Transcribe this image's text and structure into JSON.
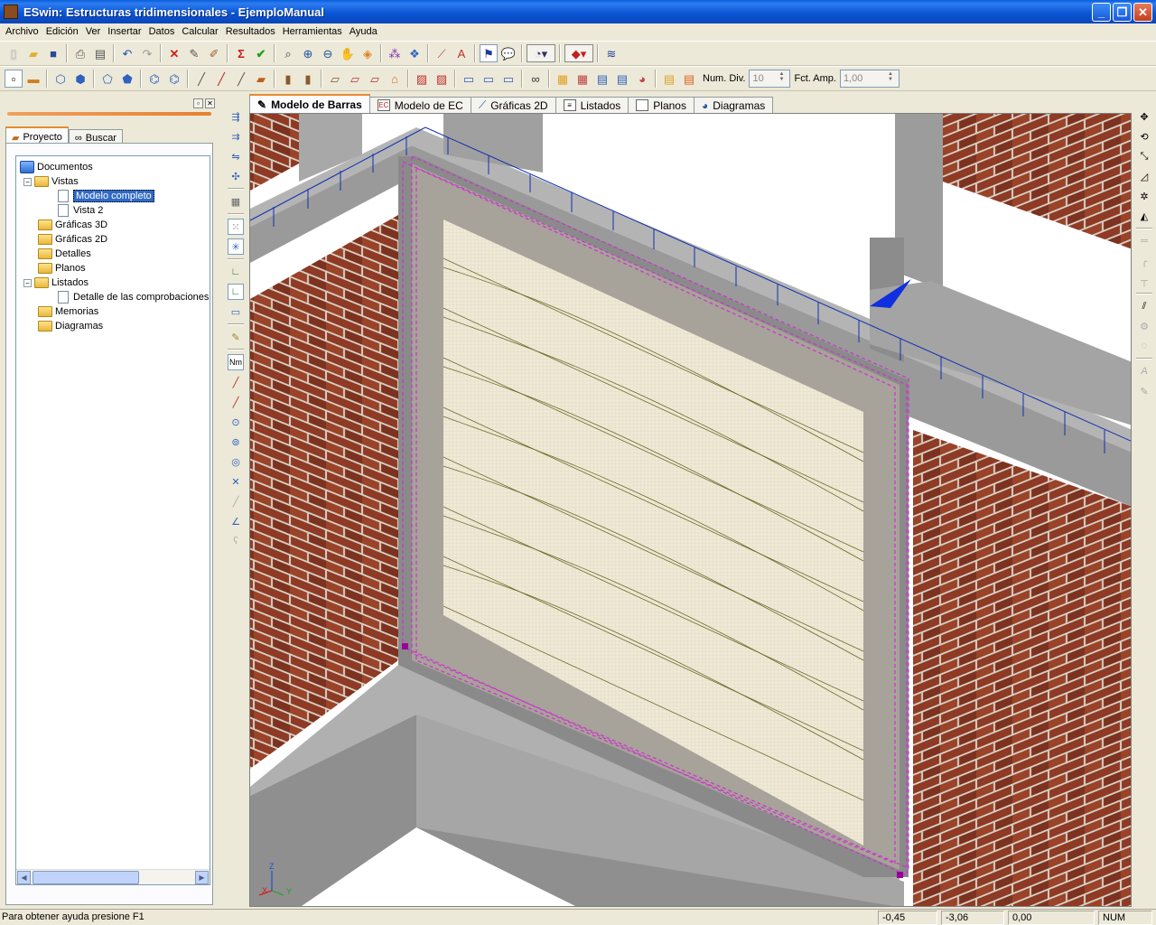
{
  "window": {
    "title": "ESwin: Estructuras tridimensionales - EjemploManual"
  },
  "menu": [
    "Archivo",
    "Edición",
    "Ver",
    "Insertar",
    "Datos",
    "Calcular",
    "Resultados",
    "Herramientas",
    "Ayuda"
  ],
  "toolbar": {
    "num_div_label": "Num. Div.",
    "num_div_value": "10",
    "fct_amp_label": "Fct. Amp.",
    "fct_amp_value": "1,00"
  },
  "left_panel": {
    "tabs": [
      "Proyecto",
      "Buscar"
    ],
    "tree": {
      "root": "Documentos",
      "vistas": "Vistas",
      "modelo_completo": "Modelo completo",
      "vista2": "Vista 2",
      "graficas3d": "Gráficas 3D",
      "graficas2d": "Gráficas 2D",
      "detalles": "Detalles",
      "planos": "Planos",
      "listados": "Listados",
      "detalle_comprobaciones": "Detalle de las comprobaciones",
      "memorias": "Memorias",
      "diagramas": "Diagramas"
    }
  },
  "doc_tabs": [
    "Modelo de Barras",
    "Modelo de EC",
    "Gráficas 2D",
    "Listados",
    "Planos",
    "Diagramas"
  ],
  "viewport": {
    "axes": {
      "z": "Z",
      "x": "X",
      "y": "Y"
    },
    "colors": {
      "brick": "#8e3a25",
      "beam": "#a0a0a0",
      "panel": "#efe9d6",
      "selection": "#cc33cc",
      "load": "#1030b0"
    }
  },
  "statusbar": {
    "message": "Para obtener ayuda presione F1",
    "x": "-0,45",
    "y": "-3,06",
    "z": "0,00",
    "num": "NUM"
  }
}
